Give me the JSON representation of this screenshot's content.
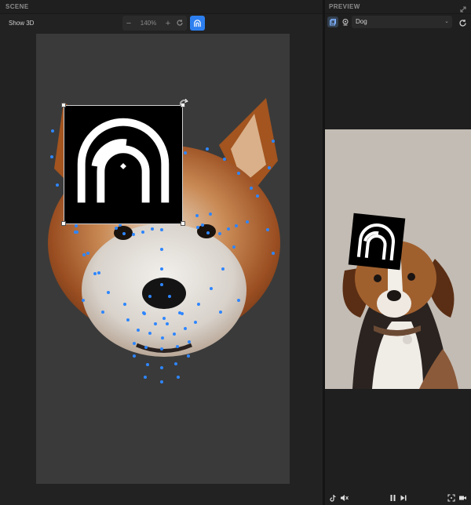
{
  "scene": {
    "title": "SCENE",
    "show3d_label": "Show 3D",
    "zoom": {
      "minus": "−",
      "value": "140%",
      "plus": "+"
    }
  },
  "preview": {
    "title": "PREVIEW",
    "selected_source": "Dog"
  },
  "colors": {
    "accent": "#2d7ff0",
    "landmark": "#2e86ff",
    "canvas": "#3a3a3a",
    "preview_bg": "#c3bcb4"
  },
  "icons": {
    "mask": "arch-logo-icon",
    "rotate": "rotate-handle-icon",
    "reload": "reload-icon",
    "expand": "expand-icon",
    "tiktok": "tiktok-icon",
    "mute": "mute-icon",
    "pause": "pause-icon",
    "step": "step-forward-icon",
    "fullscreen": "fullscreen-icon",
    "camera": "camera-icon"
  }
}
